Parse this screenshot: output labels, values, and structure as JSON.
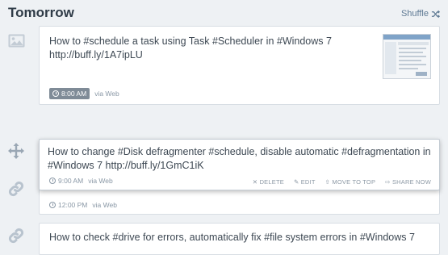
{
  "section": {
    "title": "Tomorrow",
    "shuffle_label": "Shuffle"
  },
  "posts": [
    {
      "lines": [
        "How to #schedule a task using Task #Scheduler in #Windows 7",
        "http://buff.ly/1A7ipLU"
      ],
      "time": "8:00 AM",
      "via": "via Web"
    },
    {
      "lines": [
        "How to change #Disk defragmenter #schedule, disable automatic #defragmentation in",
        "#Windows 7 http://buff.ly/1GmC1iK"
      ],
      "time": "9:00 AM",
      "via": "via Web",
      "actions": {
        "delete": "DELETE",
        "edit": "EDIT",
        "move": "MOVE TO TOP",
        "share": "SHARE NOW"
      }
    },
    {
      "time": "12:00 PM",
      "via": "via Web"
    },
    {
      "lines": [
        "How to check #drive for errors, automatically fix #file system errors in #Windows 7"
      ]
    }
  ]
}
